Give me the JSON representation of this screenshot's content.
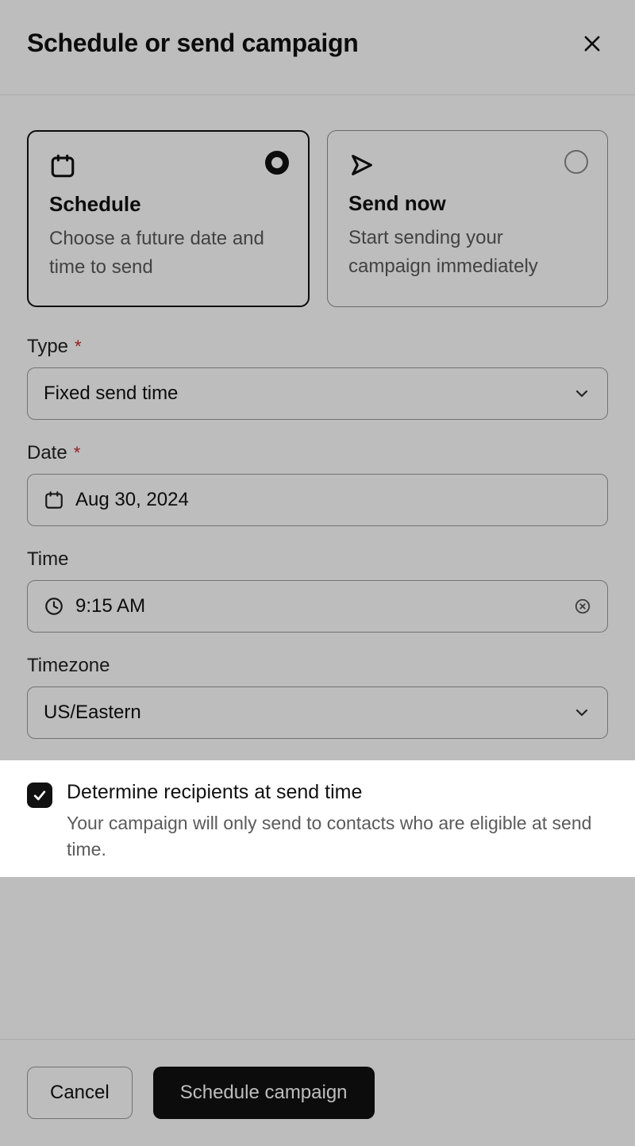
{
  "header": {
    "title": "Schedule or send campaign"
  },
  "options": {
    "schedule": {
      "title": "Schedule",
      "desc": "Choose a future date and time to send"
    },
    "send_now": {
      "title": "Send now",
      "desc": "Start sending your campaign immediately"
    }
  },
  "fields": {
    "type": {
      "label": "Type",
      "value": "Fixed send time"
    },
    "date": {
      "label": "Date",
      "value": "Aug 30, 2024"
    },
    "time": {
      "label": "Time",
      "value": "9:15 AM"
    },
    "timezone": {
      "label": "Timezone",
      "value": "US/Eastern"
    }
  },
  "determine": {
    "title": "Determine recipients at send time",
    "desc": "Your campaign will only send to contacts who are eligible at send time."
  },
  "footer": {
    "cancel": "Cancel",
    "schedule": "Schedule campaign"
  }
}
